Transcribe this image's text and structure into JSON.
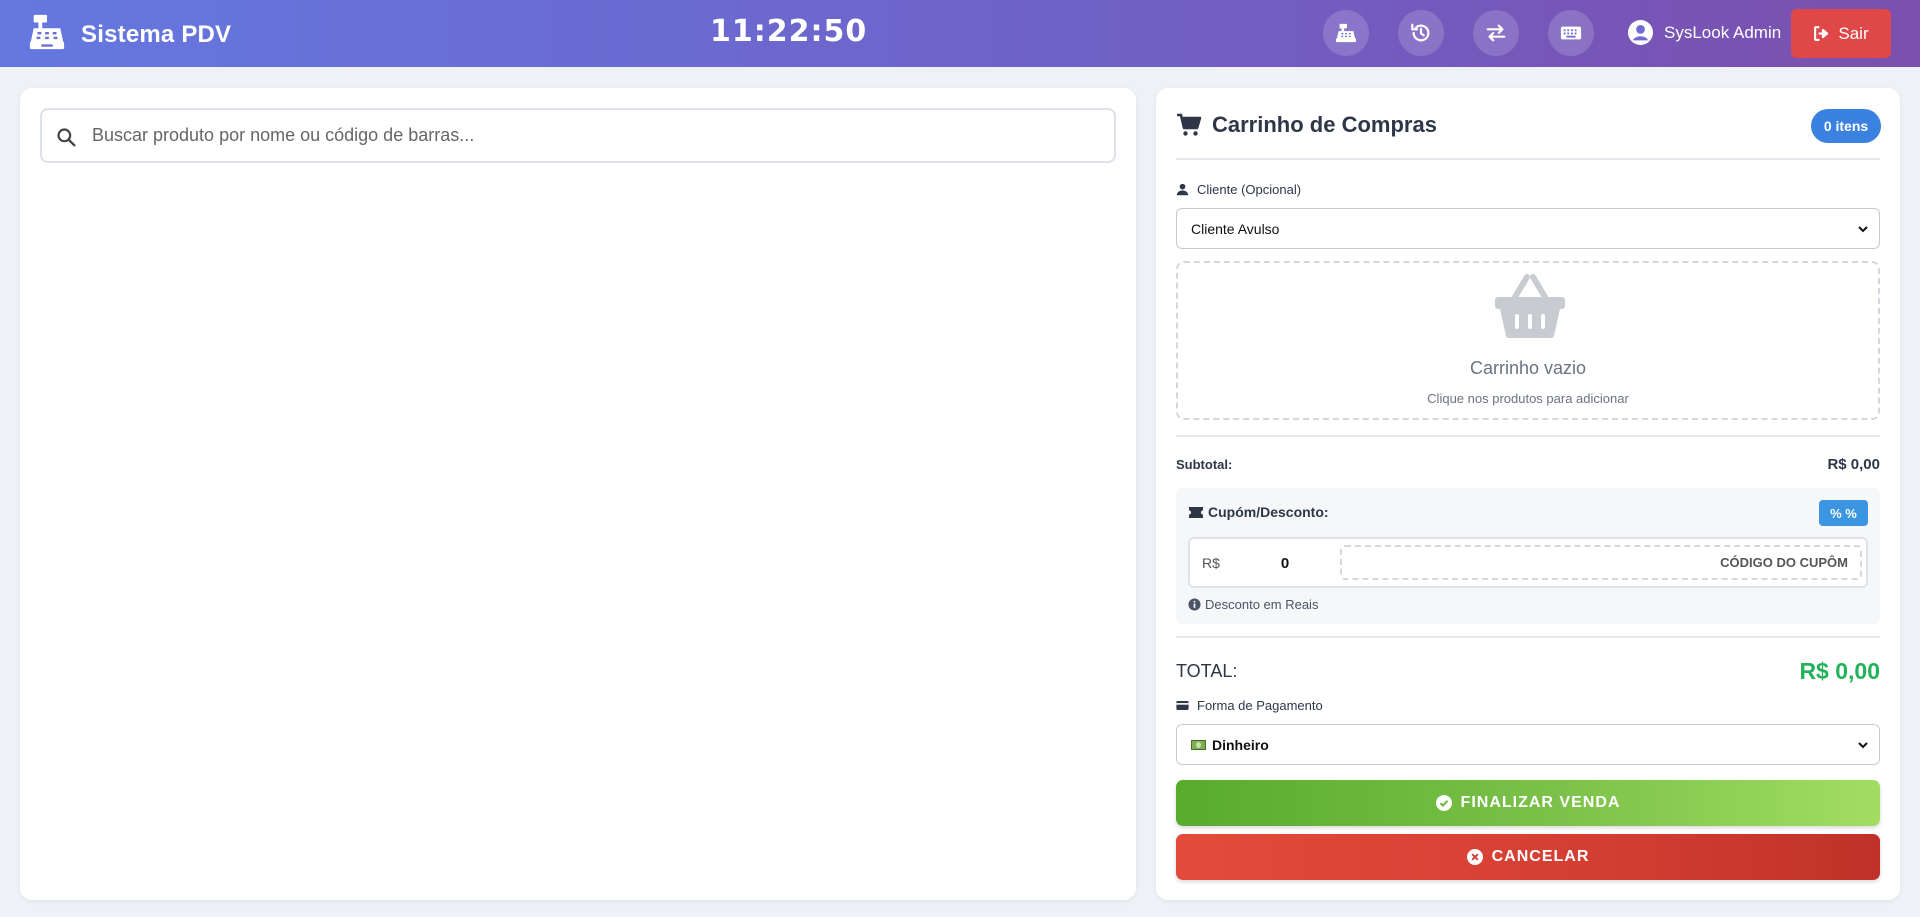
{
  "header": {
    "app_title": "Sistema PDV",
    "clock": "11:22:50",
    "icons": [
      "cash-register-icon",
      "history-icon",
      "exchange-icon",
      "keyboard-icon"
    ],
    "user_name": "SysLook Admin",
    "logout_label": "Sair"
  },
  "search": {
    "placeholder": "Buscar produto por nome ou código de barras...",
    "value": ""
  },
  "cart": {
    "title": "Carrinho de Compras",
    "item_count": "0 itens",
    "client_label": "Cliente (Opcional)",
    "client_selected": "Cliente Avulso",
    "empty_title": "Carrinho vazio",
    "empty_subtitle": "Clique nos produtos para adicionar",
    "subtotal_label": "Subtotal:",
    "subtotal_value": "R$ 0,00",
    "discount_label": "Cupóm/Desconto:",
    "discount_toggle": "% %",
    "currency_prefix": "R$",
    "discount_value": "0",
    "coupon_placeholder": "CÓDIGO DO CUPÔM",
    "discount_hint": "Desconto em Reais",
    "total_label": "TOTAL:",
    "total_value": "R$ 0,00",
    "payment_label": "Forma de Pagamento",
    "payment_selected": "Dinheiro",
    "finish_label": "FINALIZAR VENDA",
    "cancel_label": "CANCELAR"
  },
  "colors": {
    "header_gradient_start": "#6478e0",
    "header_gradient_end": "#7b4fae",
    "logout": "#e04848",
    "badge": "#3b82e0",
    "total": "#22b35a",
    "finish": "#58ab2d",
    "cancel": "#e34b3a"
  }
}
